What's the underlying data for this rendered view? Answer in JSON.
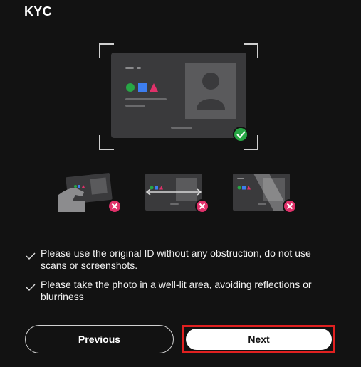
{
  "page": {
    "title": "KYC"
  },
  "illustration": {
    "main_icon": "id-card-check-illustration",
    "examples": [
      {
        "icon": "card-held-in-hand-illustration",
        "status": "invalid"
      },
      {
        "icon": "card-stretched-illustration",
        "status": "invalid"
      },
      {
        "icon": "card-glare-illustration",
        "status": "invalid"
      }
    ],
    "colors": {
      "valid": "#27a745",
      "invalid": "#e0316a",
      "card": "#3a3a3c"
    }
  },
  "tips": [
    {
      "text": "Please use the original ID without any obstruction, do not use scans or screenshots."
    },
    {
      "text": "Please take the photo in a well-lit area, avoiding reflections or blurriness"
    }
  ],
  "buttons": {
    "previous": "Previous",
    "next": "Next"
  }
}
